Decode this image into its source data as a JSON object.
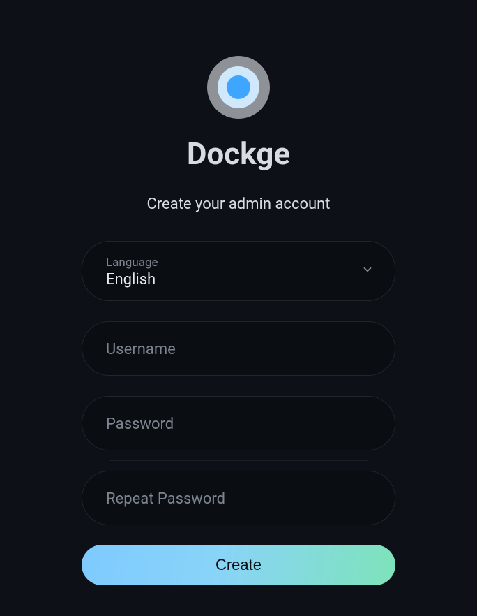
{
  "app": {
    "title": "Dockge",
    "subtitle": "Create your admin account"
  },
  "form": {
    "language": {
      "label": "Language",
      "value": "English"
    },
    "username": {
      "placeholder": "Username",
      "value": ""
    },
    "password": {
      "placeholder": "Password",
      "value": ""
    },
    "repeat_password": {
      "placeholder": "Repeat Password",
      "value": ""
    },
    "submit_label": "Create"
  },
  "icons": {
    "chevron_down": "chevron-down-icon",
    "logo": "dockge-logo"
  }
}
